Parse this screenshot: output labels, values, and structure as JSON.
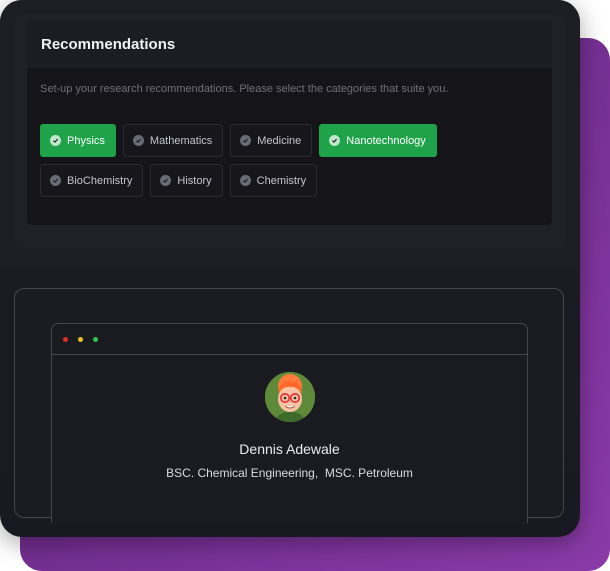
{
  "recommendations": {
    "title": "Recommendations",
    "subtitle": "Set-up your research recommendations. Please select the categories that suite you.",
    "categories_row1": [
      {
        "label": "Physics",
        "selected": true
      },
      {
        "label": "Mathematics",
        "selected": false
      },
      {
        "label": "Medicine",
        "selected": false
      },
      {
        "label": "Nanotechnology",
        "selected": true
      }
    ],
    "categories_row2": [
      {
        "label": "BioChemistry",
        "selected": false
      },
      {
        "label": "History",
        "selected": false
      },
      {
        "label": "Chemistry",
        "selected": false
      }
    ]
  },
  "profile": {
    "name": "Dennis Adewale",
    "degrees": "BSC. Chemical Engineering,  MSC. Petroleum"
  },
  "window_dots": [
    "#e0302b",
    "#e5c620",
    "#2ec84a"
  ],
  "colors": {
    "accent_green": "#1fa34a",
    "background": "#1c1d23",
    "purple": "#6d2c8c"
  },
  "icons": {
    "chip_check": "check-circle-icon",
    "avatar": "avatar"
  }
}
